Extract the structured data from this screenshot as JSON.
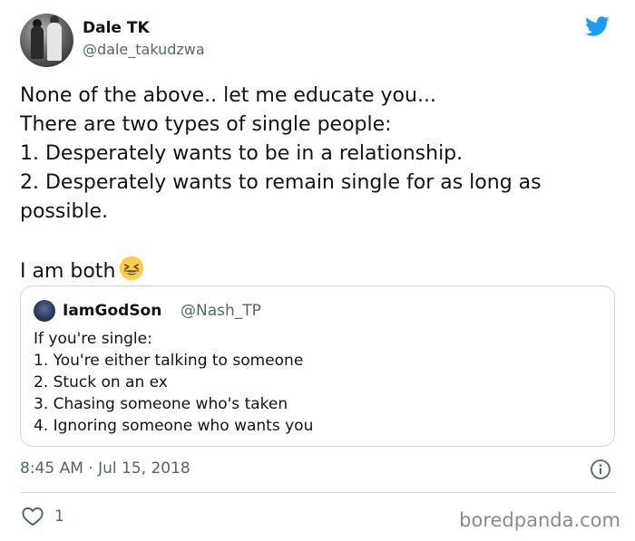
{
  "author": {
    "name": "Dale TK",
    "handle": "@dale_takudzwa"
  },
  "tweet": {
    "lines": [
      "None of the above.. let me educate you...",
      "There are two types of single people:",
      "1. Desperately wants to be in a relationship.",
      "2. Desperately wants to remain single for as long as",
      "possible.",
      "I am both"
    ],
    "emoji": "grinning-squinting-face"
  },
  "quoted_tweet": {
    "name": "IamGodSon",
    "handle": "@Nash_TP",
    "lines": [
      "If you're single:",
      "1. You're either talking to someone",
      "2. Stuck on an ex",
      "3. Chasing someone who's taken",
      "4. Ignoring someone who wants you"
    ]
  },
  "meta": {
    "timestamp": "8:45 AM · Jul 15, 2018",
    "like_count": "1"
  },
  "watermark": "boredpanda.com",
  "colors": {
    "twitter_blue": "#1d9bf0",
    "secondary_text": "#536471",
    "border": "#cfd9de",
    "emoji_yellow": "#ffcc4d"
  },
  "icons": [
    "twitter-bird-icon",
    "info-icon",
    "heart-icon"
  ]
}
